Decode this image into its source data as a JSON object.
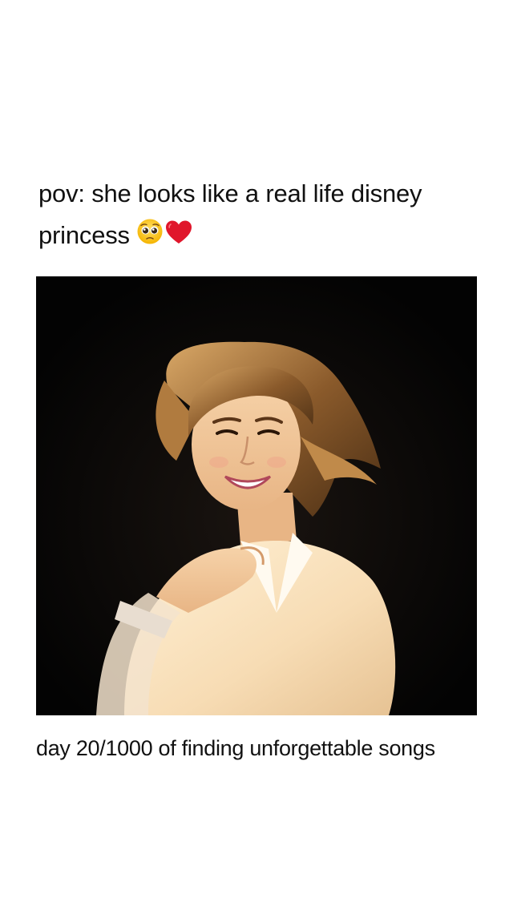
{
  "post": {
    "caption_line1": "pov: she looks like a real life disney",
    "caption_line2": "princess",
    "emojis": [
      "pleading-face-icon",
      "red-heart-icon"
    ],
    "footer": "day 20/1000 of finding unforgettable songs"
  },
  "colors": {
    "background": "#ffffff",
    "text": "#111111",
    "photo_background": "#050505"
  }
}
